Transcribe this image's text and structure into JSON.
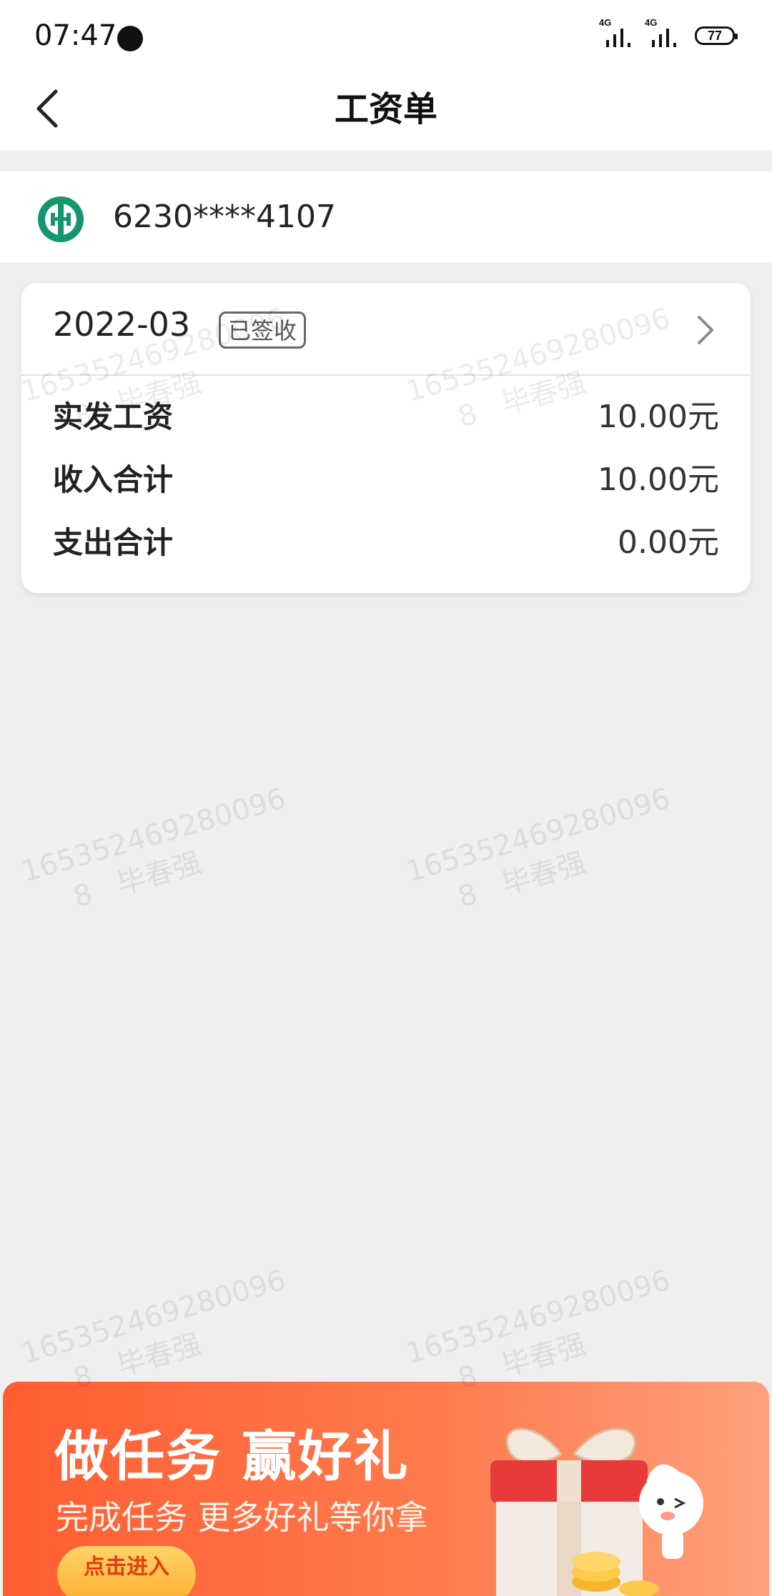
{
  "status_bar": {
    "time": "07:47",
    "network_1": "4G",
    "network_2": "4G",
    "battery": "77"
  },
  "header": {
    "title": "工资单",
    "back_icon": "chevron-left-icon"
  },
  "account": {
    "bank_icon": "bank-logo-icon",
    "number": "6230****4107"
  },
  "salary_card": {
    "month": "2022-03",
    "status_badge": "已签收",
    "rows": [
      {
        "label": "实发工资",
        "value": "10.00元"
      },
      {
        "label": "收入合计",
        "value": "10.00元"
      },
      {
        "label": "支出合计",
        "value": "0.00元"
      }
    ]
  },
  "watermark": {
    "id": "16535246928009",
    "id_tail": "6",
    "line2_digit": "8",
    "name": "毕春强"
  },
  "promo": {
    "title": "做任务 赢好礼",
    "subtitle": "完成任务 更多好礼等你拿",
    "button_label": "点击进入"
  }
}
